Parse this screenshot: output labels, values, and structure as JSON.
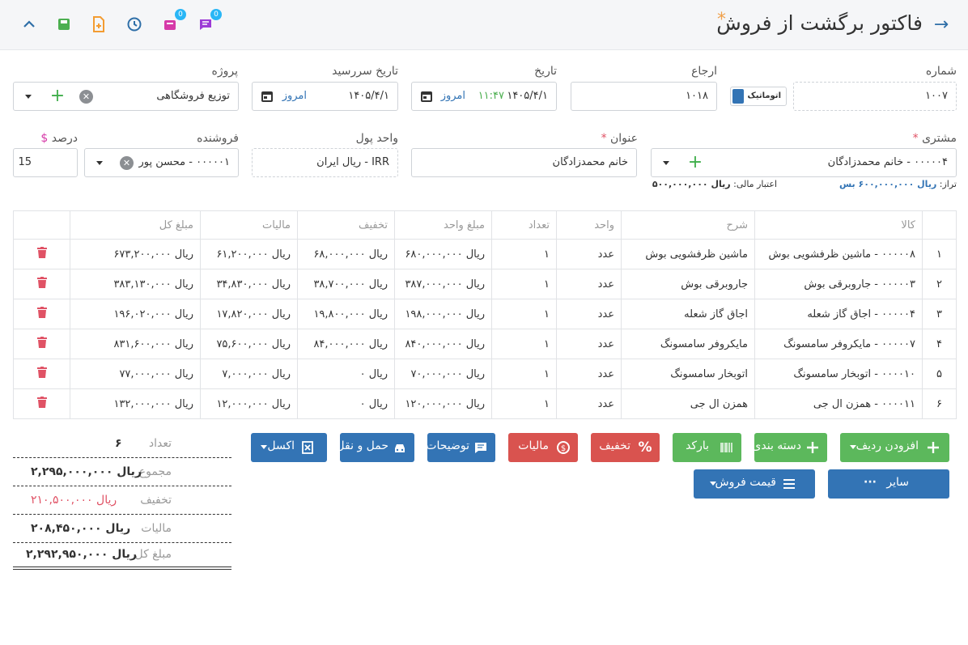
{
  "header": {
    "title": "فاکتور برگشت از فروش",
    "star": "*",
    "badge_notes": "0",
    "badge_box": "0"
  },
  "form": {
    "number": {
      "label": "شماره",
      "value": "۱۰۰۷",
      "auto_label": "اتوماتیک"
    },
    "reference": {
      "label": "ارجاع",
      "value": "۱۰۱۸"
    },
    "date": {
      "label": "تاریخ",
      "value": "۱۴۰۵/۴/۱",
      "time": "۱۱:۴۷",
      "today": "امروز"
    },
    "due_date": {
      "label": "تاریخ سررسید",
      "value": "۱۴۰۵/۴/۱",
      "today": "امروز"
    },
    "project": {
      "label": "پروژه",
      "value": "توزیع فروشگاهی"
    },
    "customer": {
      "label": "مشتری",
      "value": "۰۰۰۰۰۴ - خانم محمدزادگان"
    },
    "subject": {
      "label": "عنوان",
      "value": "خانم محمدزادگان"
    },
    "currency": {
      "label": "واحد پول",
      "value": "IRR - ریال ایران"
    },
    "seller": {
      "label": "فروشنده",
      "value": "۰۰۰۰۰۱ - محسن پور"
    },
    "percent": {
      "label": "درصد",
      "value": "15",
      "currency_sign": "$"
    },
    "balance_label": "تراز:",
    "balance_value": "ریال ۶۰۰,۰۰۰,۰۰۰ بس",
    "credit_label": "اعتبار مالی:",
    "credit_value": "ریال ۵۰۰,۰۰۰,۰۰۰"
  },
  "table": {
    "headers": [
      "کالا",
      "شرح",
      "واحد",
      "تعداد",
      "مبلغ واحد",
      "تخفیف",
      "مالیات",
      "مبلغ کل"
    ],
    "rows": [
      {
        "idx": "۱",
        "item": "۰۰۰۰۰۸ - ماشین ظرفشویی بوش",
        "desc": "ماشین ظرفشویی بوش",
        "unit": "عدد",
        "qty": "۱",
        "price": "ریال ۶۸۰,۰۰۰,۰۰۰",
        "discount": "ریال ۶۸,۰۰۰,۰۰۰",
        "tax": "ریال ۶۱,۲۰۰,۰۰۰",
        "total": "ریال ۶۷۳,۲۰۰,۰۰۰"
      },
      {
        "idx": "۲",
        "item": "۰۰۰۰۰۳ - جاروبرقی بوش",
        "desc": "جاروبرقی بوش",
        "unit": "عدد",
        "qty": "۱",
        "price": "ریال ۳۸۷,۰۰۰,۰۰۰",
        "discount": "ریال ۳۸,۷۰۰,۰۰۰",
        "tax": "ریال ۳۴,۸۳۰,۰۰۰",
        "total": "ریال ۳۸۳,۱۳۰,۰۰۰"
      },
      {
        "idx": "۳",
        "item": "۰۰۰۰۰۴ - اجاق گاز شعله",
        "desc": "اجاق گاز شعله",
        "unit": "عدد",
        "qty": "۱",
        "price": "ریال ۱۹۸,۰۰۰,۰۰۰",
        "discount": "ریال ۱۹,۸۰۰,۰۰۰",
        "tax": "ریال ۱۷,۸۲۰,۰۰۰",
        "total": "ریال ۱۹۶,۰۲۰,۰۰۰"
      },
      {
        "idx": "۴",
        "item": "۰۰۰۰۰۷ - مایکروفر سامسونگ",
        "desc": "مایکروفر سامسونگ",
        "unit": "عدد",
        "qty": "۱",
        "price": "ریال ۸۴۰,۰۰۰,۰۰۰",
        "discount": "ریال ۸۴,۰۰۰,۰۰۰",
        "tax": "ریال ۷۵,۶۰۰,۰۰۰",
        "total": "ریال ۸۳۱,۶۰۰,۰۰۰"
      },
      {
        "idx": "۵",
        "item": "۰۰۰۰۱۰ - اتوبخار سامسونگ",
        "desc": "اتوبخار سامسونگ",
        "unit": "عدد",
        "qty": "۱",
        "price": "ریال ۷۰,۰۰۰,۰۰۰",
        "discount": "ریال ۰",
        "tax": "ریال ۷,۰۰۰,۰۰۰",
        "total": "ریال ۷۷,۰۰۰,۰۰۰"
      },
      {
        "idx": "۶",
        "item": "۰۰۰۰۱۱ - همزن ال جی",
        "desc": "همزن ال جی",
        "unit": "عدد",
        "qty": "۱",
        "price": "ریال ۱۲۰,۰۰۰,۰۰۰",
        "discount": "ریال ۰",
        "tax": "ریال ۱۲,۰۰۰,۰۰۰",
        "total": "ریال ۱۳۲,۰۰۰,۰۰۰"
      }
    ]
  },
  "actions": {
    "add_row": "افزودن ردیف",
    "category": "دسته بندی",
    "barcode": "بارکد",
    "discount": "تخفیف",
    "tax": "مالیات",
    "notes": "توضیحات",
    "shipping": "حمل و نقل",
    "excel": "اکسل",
    "other": "سایر",
    "sale_price": "قیمت فروش"
  },
  "totals": {
    "count_label": "تعداد",
    "count_value": "۶",
    "sum_label": "مجموع",
    "sum_value": "ریال ۲,۲۹۵,۰۰۰,۰۰۰",
    "discount_label": "تخفیف",
    "discount_value": "ریال ۲۱۰,۵۰۰,۰۰۰",
    "tax_label": "مالیات",
    "tax_value": "ریال ۲۰۸,۴۵۰,۰۰۰",
    "grand_label": "مبلغ کل",
    "grand_value": "ریال ۲,۲۹۲,۹۵۰,۰۰۰"
  },
  "colors": {
    "primary": "#3374b5",
    "success": "#5cb85c",
    "danger": "#d9534f",
    "accent_star": "#f0a04b",
    "badge": "#29b6f6"
  }
}
